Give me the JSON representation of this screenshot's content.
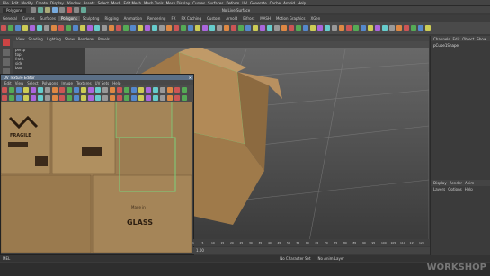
{
  "menubar": [
    "File",
    "Edit",
    "Modify",
    "Create",
    "Display",
    "Window",
    "Assets",
    "Select",
    "Mesh",
    "Edit Mesh",
    "Mesh Tools",
    "Mesh Display",
    "Curves",
    "Surfaces",
    "Deform",
    "UV",
    "Generate",
    "Cache",
    "Arnold",
    "Help"
  ],
  "status": {
    "mode": "Polygons",
    "live": "No Live Surface"
  },
  "shelf_tabs": [
    "General",
    "Curves",
    "Surfaces",
    "Polygons",
    "Sculpting",
    "Rigging",
    "Animation",
    "Rendering",
    "FX",
    "FX Caching",
    "Custom",
    "Arnold",
    "Bifrost",
    "MASH",
    "Motion Graphics",
    "XGen"
  ],
  "shelf_active": "Polygons",
  "viewport": {
    "menu": [
      "View",
      "Shading",
      "Lighting",
      "Show",
      "Renderer",
      "Panels"
    ]
  },
  "outliner": {
    "items": [
      "persp",
      "top",
      "front",
      "side",
      "box"
    ]
  },
  "uv_editor": {
    "title": "UV Texture Editor",
    "menu": [
      "Edit",
      "View",
      "Select",
      "Polygons",
      "Image",
      "Textures",
      "UV Sets",
      "Help"
    ],
    "labels": {
      "fragile": "FRAGILE",
      "glass": "GLASS",
      "made": "Made in"
    }
  },
  "right_panel": {
    "tabs": [
      "Channels",
      "Edit",
      "Object",
      "Show"
    ],
    "object": "pCube1Shape",
    "layer_tabs": [
      "Display",
      "Render",
      "Anim"
    ],
    "layer_menu": [
      "Layers",
      "Options",
      "Help"
    ]
  },
  "timeline": {
    "ticks": [
      "1",
      "5",
      "10",
      "15",
      "20",
      "25",
      "30",
      "35",
      "40",
      "45",
      "50",
      "55",
      "60",
      "65",
      "70",
      "75",
      "80",
      "85",
      "90",
      "95",
      "100",
      "105",
      "110",
      "115",
      "120"
    ],
    "current": "1.00"
  },
  "cmdline": {
    "label": "MEL",
    "char_set": "No Character Set",
    "anim_layer": "No Anim Layer"
  },
  "watermark": "WORKSHOP",
  "colors": {
    "accent": "#5b6f86",
    "box": "#b28a57",
    "uvborder": "#7cd17c"
  }
}
